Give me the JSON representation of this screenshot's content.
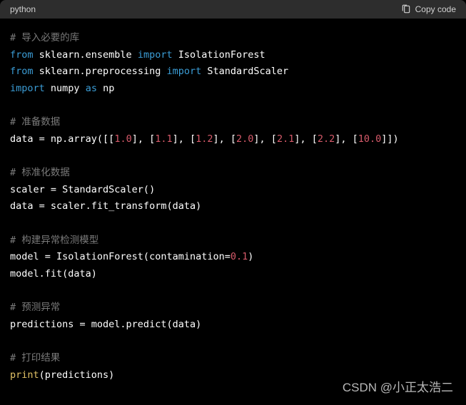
{
  "header": {
    "language": "python",
    "copy_label": "Copy code"
  },
  "code": {
    "c1": "# 导入必要的库",
    "l2_kw1": "from",
    "l2_t1": " sklearn.ensemble ",
    "l2_kw2": "import",
    "l2_t2": " IsolationForest",
    "l3_kw1": "from",
    "l3_t1": " sklearn.preprocessing ",
    "l3_kw2": "import",
    "l3_t2": " StandardScaler",
    "l4_kw1": "import",
    "l4_t1": " numpy ",
    "l4_kw2": "as",
    "l4_t2": " np",
    "c2": "# 准备数据",
    "l6_a": "data = np.array([[",
    "l6_n1": "1.0",
    "l6_b": "], [",
    "l6_n2": "1.1",
    "l6_c": "], [",
    "l6_n3": "1.2",
    "l6_d": "], [",
    "l6_n4": "2.0",
    "l6_e": "], [",
    "l6_n5": "2.1",
    "l6_f": "], [",
    "l6_n6": "2.2",
    "l6_g": "], [",
    "l6_n7": "10.0",
    "l6_h": "]])",
    "c3": "# 标准化数据",
    "l8": "scaler = StandardScaler()",
    "l9": "data = scaler.fit_transform(data)",
    "c4": "# 构建异常检测模型",
    "l11_a": "model = IsolationForest(contamination=",
    "l11_n": "0.1",
    "l11_b": ")",
    "l12": "model.fit(data)",
    "c5": "# 预测异常",
    "l14": "predictions = model.predict(data)",
    "c6": "# 打印结果",
    "l16_fn": "print",
    "l16_a": "(predictions)"
  },
  "watermark": "CSDN @小正太浩二"
}
